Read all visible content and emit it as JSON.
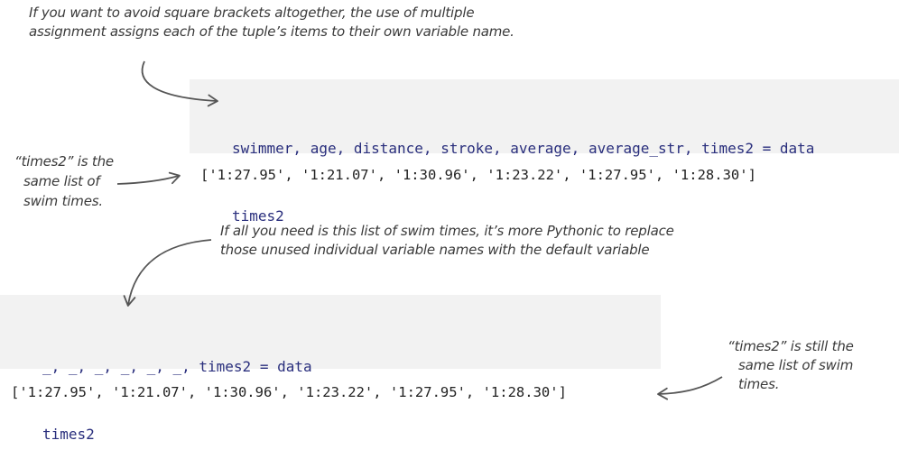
{
  "annotations": {
    "top": [
      "If you want to avoid square brackets altogether, the use of multiple",
      "assignment assigns each of the tuple’s items to their own variable name."
    ],
    "left": [
      "“times2” is the",
      "same list of",
      "swim times."
    ],
    "middle": [
      "If all you need is this list of swim times, it’s more Pythonic to replace",
      "those unused individual variable names with the default variable"
    ],
    "right": [
      "“times2” is still the",
      "same list of swim",
      "times."
    ]
  },
  "code_block_1": {
    "line1": "swimmer, age, distance, stroke, average, average_str, times2 = data",
    "line2": "times2"
  },
  "output_1": "['1:27.95', '1:21.07', '1:30.96', '1:23.22', '1:27.95', '1:28.30']",
  "code_block_2": {
    "line1": "_, _, _, _, _, _, times2 = data",
    "line2": "times2"
  },
  "output_2": "['1:27.95', '1:21.07', '1:30.96', '1:23.22', '1:27.95', '1:28.30']"
}
